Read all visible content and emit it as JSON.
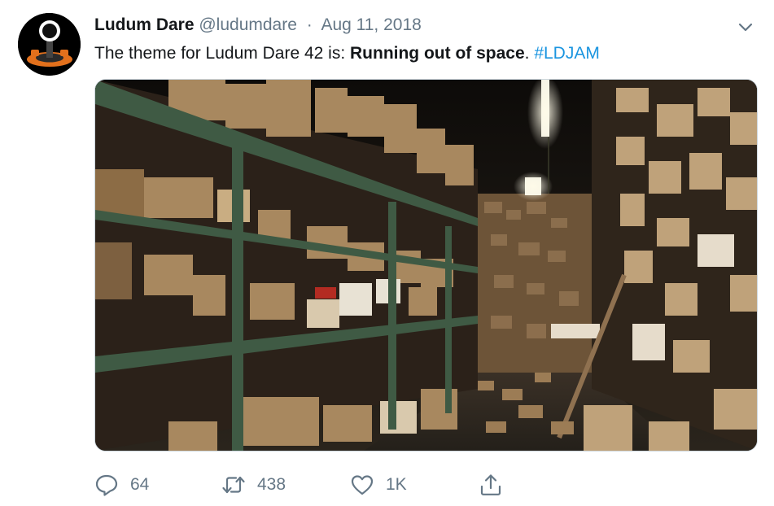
{
  "tweet": {
    "author": {
      "display_name": "Ludum Dare",
      "handle": "@ludumdare",
      "avatar_icon": "joystick-icon"
    },
    "separator": "·",
    "date": "Aug 11, 2018",
    "text": {
      "prefix": "The theme for Ludum Dare 42 is: ",
      "theme": "Running out of space",
      "suffix": ". ",
      "hashtag": "#LDJAM"
    },
    "media": {
      "kind": "photo"
    },
    "actions": {
      "reply": {
        "icon": "reply-icon",
        "count": "64"
      },
      "retweet": {
        "icon": "retweet-icon",
        "count": "438"
      },
      "like": {
        "icon": "heart-icon",
        "count": "1K"
      },
      "share": {
        "icon": "share-icon"
      }
    },
    "menu_icon": "chevron-down-icon"
  },
  "colors": {
    "text": "#14171a",
    "secondary": "#657786",
    "link": "#1b95e0",
    "border": "#ccd6dd"
  }
}
